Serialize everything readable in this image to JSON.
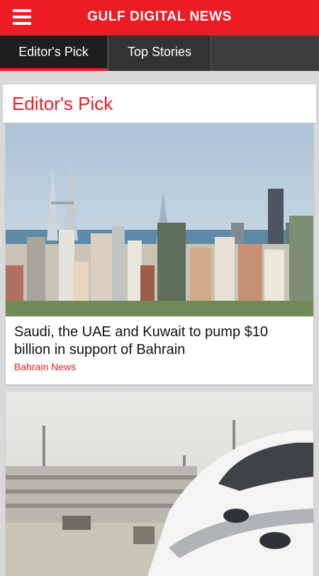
{
  "app": {
    "title": "GULF DIGITAL NEWS"
  },
  "tabs": [
    {
      "label": "Editor's Pick",
      "active": true
    },
    {
      "label": "Top Stories",
      "active": false
    }
  ],
  "section": {
    "title": "Editor's Pick"
  },
  "articles": [
    {
      "headline": "Saudi, the UAE and Kuwait to pump $10 billion in support of Bahrain",
      "category": "Bahrain News",
      "image": "city-skyline-photo"
    },
    {
      "headline": "",
      "category": "",
      "image": "high-speed-train-photo"
    }
  ],
  "colors": {
    "brand": "#ee1c24",
    "tabbar": "#3d3d3d",
    "background": "#d9d9d9"
  }
}
